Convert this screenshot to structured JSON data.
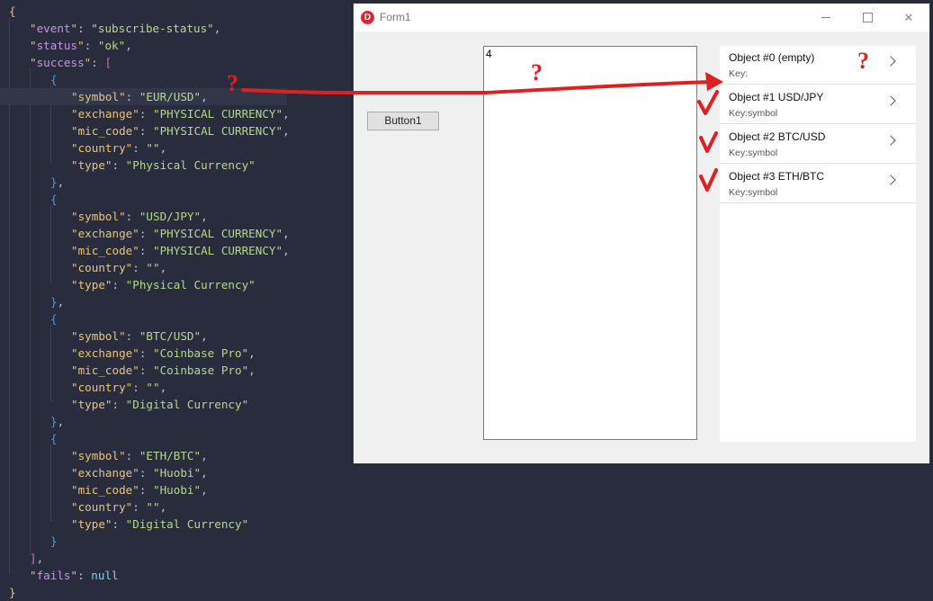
{
  "editor": {
    "lines": [
      {
        "indent": 0,
        "tokens": [
          {
            "t": "{",
            "c": "c-brace-y"
          }
        ]
      },
      {
        "indent": 1,
        "tokens": [
          {
            "t": "\"",
            "c": "c-quote"
          },
          {
            "t": "event",
            "c": "c-key-top"
          },
          {
            "t": "\"",
            "c": "c-quote"
          },
          {
            "t": ": ",
            "c": "c-punc"
          },
          {
            "t": "\"subscribe-status\"",
            "c": "c-str"
          },
          {
            "t": ",",
            "c": "c-punc"
          }
        ]
      },
      {
        "indent": 1,
        "tokens": [
          {
            "t": "\"",
            "c": "c-quote"
          },
          {
            "t": "status",
            "c": "c-key-top"
          },
          {
            "t": "\"",
            "c": "c-quote"
          },
          {
            "t": ": ",
            "c": "c-punc"
          },
          {
            "t": "\"ok\"",
            "c": "c-str"
          },
          {
            "t": ",",
            "c": "c-punc"
          }
        ]
      },
      {
        "indent": 1,
        "tokens": [
          {
            "t": "\"",
            "c": "c-quote"
          },
          {
            "t": "success",
            "c": "c-key-top"
          },
          {
            "t": "\"",
            "c": "c-quote"
          },
          {
            "t": ": ",
            "c": "c-punc"
          },
          {
            "t": "[",
            "c": "c-brace-p"
          }
        ]
      },
      {
        "indent": 2,
        "tokens": [
          {
            "t": "{",
            "c": "c-brace-b"
          }
        ]
      },
      {
        "indent": 3,
        "highlight": true,
        "tokens": [
          {
            "t": "\"symbol\"",
            "c": "c-key"
          },
          {
            "t": ": ",
            "c": "c-punc"
          },
          {
            "t": "\"EUR/USD\"",
            "c": "c-str"
          },
          {
            "t": ",",
            "c": "c-punc"
          }
        ]
      },
      {
        "indent": 3,
        "tokens": [
          {
            "t": "\"exchange\"",
            "c": "c-key"
          },
          {
            "t": ": ",
            "c": "c-punc"
          },
          {
            "t": "\"PHYSICAL CURRENCY\"",
            "c": "c-str"
          },
          {
            "t": ",",
            "c": "c-punc"
          }
        ]
      },
      {
        "indent": 3,
        "tokens": [
          {
            "t": "\"mic_code\"",
            "c": "c-key"
          },
          {
            "t": ": ",
            "c": "c-punc"
          },
          {
            "t": "\"PHYSICAL CURRENCY\"",
            "c": "c-str"
          },
          {
            "t": ",",
            "c": "c-punc"
          }
        ]
      },
      {
        "indent": 3,
        "tokens": [
          {
            "t": "\"country\"",
            "c": "c-key"
          },
          {
            "t": ": ",
            "c": "c-punc"
          },
          {
            "t": "\"\"",
            "c": "c-str"
          },
          {
            "t": ",",
            "c": "c-punc"
          }
        ]
      },
      {
        "indent": 3,
        "tokens": [
          {
            "t": "\"type\"",
            "c": "c-key"
          },
          {
            "t": ": ",
            "c": "c-punc"
          },
          {
            "t": "\"Physical Currency\"",
            "c": "c-str"
          }
        ]
      },
      {
        "indent": 2,
        "tokens": [
          {
            "t": "}",
            "c": "c-brace-b"
          },
          {
            "t": ",",
            "c": "c-punc"
          }
        ]
      },
      {
        "indent": 2,
        "tokens": [
          {
            "t": "{",
            "c": "c-brace-b"
          }
        ]
      },
      {
        "indent": 3,
        "tokens": [
          {
            "t": "\"symbol\"",
            "c": "c-key"
          },
          {
            "t": ": ",
            "c": "c-punc"
          },
          {
            "t": "\"USD/JPY\"",
            "c": "c-str"
          },
          {
            "t": ",",
            "c": "c-punc"
          }
        ]
      },
      {
        "indent": 3,
        "tokens": [
          {
            "t": "\"exchange\"",
            "c": "c-key"
          },
          {
            "t": ": ",
            "c": "c-punc"
          },
          {
            "t": "\"PHYSICAL CURRENCY\"",
            "c": "c-str"
          },
          {
            "t": ",",
            "c": "c-punc"
          }
        ]
      },
      {
        "indent": 3,
        "tokens": [
          {
            "t": "\"mic_code\"",
            "c": "c-key"
          },
          {
            "t": ": ",
            "c": "c-punc"
          },
          {
            "t": "\"PHYSICAL CURRENCY\"",
            "c": "c-str"
          },
          {
            "t": ",",
            "c": "c-punc"
          }
        ]
      },
      {
        "indent": 3,
        "tokens": [
          {
            "t": "\"country\"",
            "c": "c-key"
          },
          {
            "t": ": ",
            "c": "c-punc"
          },
          {
            "t": "\"\"",
            "c": "c-str"
          },
          {
            "t": ",",
            "c": "c-punc"
          }
        ]
      },
      {
        "indent": 3,
        "tokens": [
          {
            "t": "\"type\"",
            "c": "c-key"
          },
          {
            "t": ": ",
            "c": "c-punc"
          },
          {
            "t": "\"Physical Currency\"",
            "c": "c-str"
          }
        ]
      },
      {
        "indent": 2,
        "tokens": [
          {
            "t": "}",
            "c": "c-brace-b"
          },
          {
            "t": ",",
            "c": "c-punc"
          }
        ]
      },
      {
        "indent": 2,
        "tokens": [
          {
            "t": "{",
            "c": "c-brace-b"
          }
        ]
      },
      {
        "indent": 3,
        "tokens": [
          {
            "t": "\"symbol\"",
            "c": "c-key"
          },
          {
            "t": ": ",
            "c": "c-punc"
          },
          {
            "t": "\"BTC/USD\"",
            "c": "c-str"
          },
          {
            "t": ",",
            "c": "c-punc"
          }
        ]
      },
      {
        "indent": 3,
        "tokens": [
          {
            "t": "\"exchange\"",
            "c": "c-key"
          },
          {
            "t": ": ",
            "c": "c-punc"
          },
          {
            "t": "\"Coinbase Pro\"",
            "c": "c-str"
          },
          {
            "t": ",",
            "c": "c-punc"
          }
        ]
      },
      {
        "indent": 3,
        "tokens": [
          {
            "t": "\"mic_code\"",
            "c": "c-key"
          },
          {
            "t": ": ",
            "c": "c-punc"
          },
          {
            "t": "\"Coinbase Pro\"",
            "c": "c-str"
          },
          {
            "t": ",",
            "c": "c-punc"
          }
        ]
      },
      {
        "indent": 3,
        "tokens": [
          {
            "t": "\"country\"",
            "c": "c-key"
          },
          {
            "t": ": ",
            "c": "c-punc"
          },
          {
            "t": "\"\"",
            "c": "c-str"
          },
          {
            "t": ",",
            "c": "c-punc"
          }
        ]
      },
      {
        "indent": 3,
        "tokens": [
          {
            "t": "\"type\"",
            "c": "c-key"
          },
          {
            "t": ": ",
            "c": "c-punc"
          },
          {
            "t": "\"Digital Currency\"",
            "c": "c-str"
          }
        ]
      },
      {
        "indent": 2,
        "tokens": [
          {
            "t": "}",
            "c": "c-brace-b"
          },
          {
            "t": ",",
            "c": "c-punc"
          }
        ]
      },
      {
        "indent": 2,
        "tokens": [
          {
            "t": "{",
            "c": "c-brace-b"
          }
        ]
      },
      {
        "indent": 3,
        "tokens": [
          {
            "t": "\"symbol\"",
            "c": "c-key"
          },
          {
            "t": ": ",
            "c": "c-punc"
          },
          {
            "t": "\"ETH/BTC\"",
            "c": "c-str"
          },
          {
            "t": ",",
            "c": "c-punc"
          }
        ]
      },
      {
        "indent": 3,
        "tokens": [
          {
            "t": "\"exchange\"",
            "c": "c-key"
          },
          {
            "t": ": ",
            "c": "c-punc"
          },
          {
            "t": "\"Huobi\"",
            "c": "c-str"
          },
          {
            "t": ",",
            "c": "c-punc"
          }
        ]
      },
      {
        "indent": 3,
        "tokens": [
          {
            "t": "\"mic_code\"",
            "c": "c-key"
          },
          {
            "t": ": ",
            "c": "c-punc"
          },
          {
            "t": "\"Huobi\"",
            "c": "c-str"
          },
          {
            "t": ",",
            "c": "c-punc"
          }
        ]
      },
      {
        "indent": 3,
        "tokens": [
          {
            "t": "\"country\"",
            "c": "c-key"
          },
          {
            "t": ": ",
            "c": "c-punc"
          },
          {
            "t": "\"\"",
            "c": "c-str"
          },
          {
            "t": ",",
            "c": "c-punc"
          }
        ]
      },
      {
        "indent": 3,
        "tokens": [
          {
            "t": "\"type\"",
            "c": "c-key"
          },
          {
            "t": ": ",
            "c": "c-punc"
          },
          {
            "t": "\"Digital Currency\"",
            "c": "c-str"
          }
        ]
      },
      {
        "indent": 2,
        "tokens": [
          {
            "t": "}",
            "c": "c-brace-b"
          }
        ]
      },
      {
        "indent": 1,
        "tokens": [
          {
            "t": "]",
            "c": "c-brace-p"
          },
          {
            "t": ",",
            "c": "c-punc"
          }
        ]
      },
      {
        "indent": 1,
        "tokens": [
          {
            "t": "\"",
            "c": "c-quote"
          },
          {
            "t": "fails",
            "c": "c-key-top"
          },
          {
            "t": "\"",
            "c": "c-quote"
          },
          {
            "t": ": ",
            "c": "c-punc"
          },
          {
            "t": "null",
            "c": "c-null"
          }
        ]
      },
      {
        "indent": 0,
        "tokens": [
          {
            "t": "}",
            "c": "c-brace-y"
          }
        ]
      }
    ]
  },
  "window": {
    "title": "Form1",
    "app_icon_letter": "D",
    "controls": {
      "minimize": "minimize",
      "maximize": "maximize",
      "close": "close"
    },
    "close_glyph": "✕"
  },
  "form": {
    "button1_label": "Button1",
    "memo_text": "4",
    "list_items": [
      {
        "title": "Object #0 (empty)",
        "detail": "Key:"
      },
      {
        "title": "Object #1 USD/JPY",
        "detail": "Key:symbol"
      },
      {
        "title": "Object #2 BTC/USD",
        "detail": "Key:symbol"
      },
      {
        "title": "Object #3 ETH/BTC",
        "detail": "Key:symbol"
      }
    ]
  },
  "annotations": {
    "question_mark": "?",
    "color": "#e02020"
  }
}
